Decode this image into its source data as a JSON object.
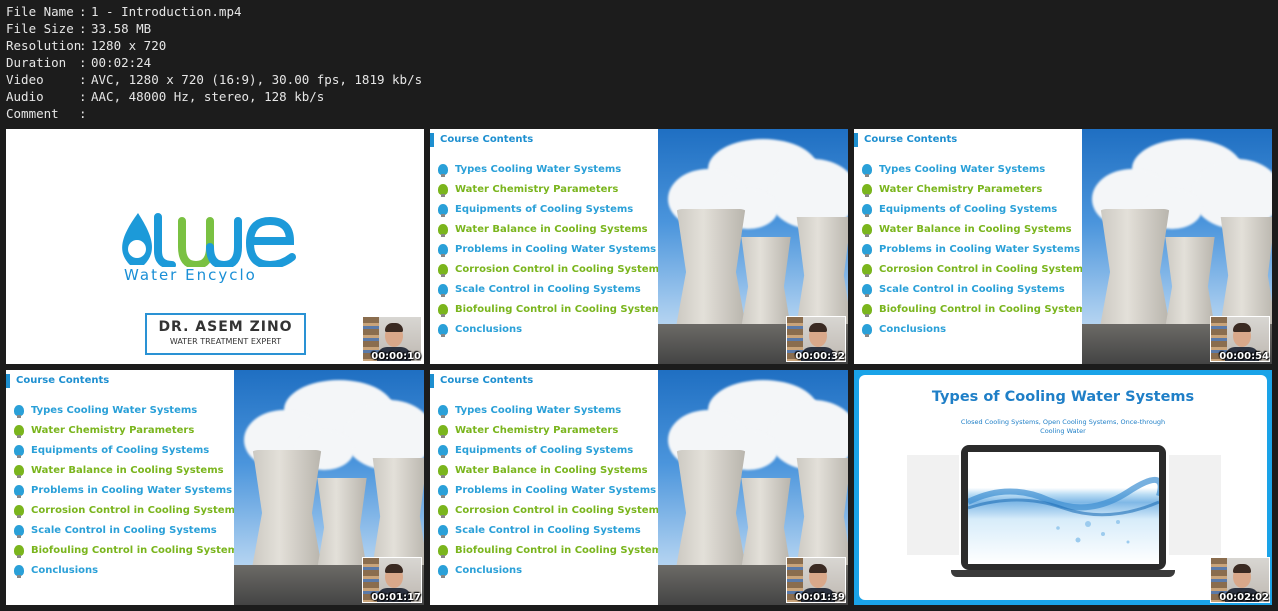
{
  "meta": [
    {
      "key": "File Name",
      "value": "1 - Introduction.mp4"
    },
    {
      "key": "File Size",
      "value": "33.58 MB"
    },
    {
      "key": "Resolution",
      "value": "1280 x 720"
    },
    {
      "key": "Duration",
      "value": "00:02:24"
    },
    {
      "key": "Video",
      "value": "AVC, 1280 x 720 (16:9), 30.00 fps, 1819 kb/s"
    },
    {
      "key": "Audio",
      "value": "AAC, 48000 Hz, stereo, 128 kb/s"
    },
    {
      "key": "Comment",
      "value": ""
    }
  ],
  "separator": ":",
  "intro": {
    "brand": "Water Encyclo",
    "name": "DR. ASEM ZINO",
    "role": "WATER TREATMENT EXPERT",
    "timestamp": "00:00:10"
  },
  "contents": {
    "title": "Course Contents",
    "items": [
      {
        "label": "Types Cooling Water Systems",
        "color": "#2aa0d8"
      },
      {
        "label": "Water Chemistry Parameters",
        "color": "#7ab51d"
      },
      {
        "label": "Equipments of Cooling Systems",
        "color": "#2aa0d8"
      },
      {
        "label": "Water Balance in Cooling Systems",
        "color": "#7ab51d"
      },
      {
        "label": "Problems in Cooling Water Systems",
        "color": "#2aa0d8"
      },
      {
        "label": "Corrosion Control in Cooling Systems",
        "color": "#7ab51d"
      },
      {
        "label": "Scale Control in Cooling Systems",
        "color": "#2aa0d8"
      },
      {
        "label": "Biofouling Control in Cooling Systems",
        "color": "#7ab51d"
      },
      {
        "label": "Conclusions",
        "color": "#2aa0d8"
      }
    ]
  },
  "timestamps": {
    "t2": "00:00:32",
    "t3": "00:00:54",
    "t4": "00:01:17",
    "t5": "00:01:39",
    "t6": "00:02:02"
  },
  "types": {
    "title": "Types of Cooling Water Systems",
    "subtitle": "Closed Cooling Systems, Open Cooling Systems, Once-through Cooling Water"
  }
}
